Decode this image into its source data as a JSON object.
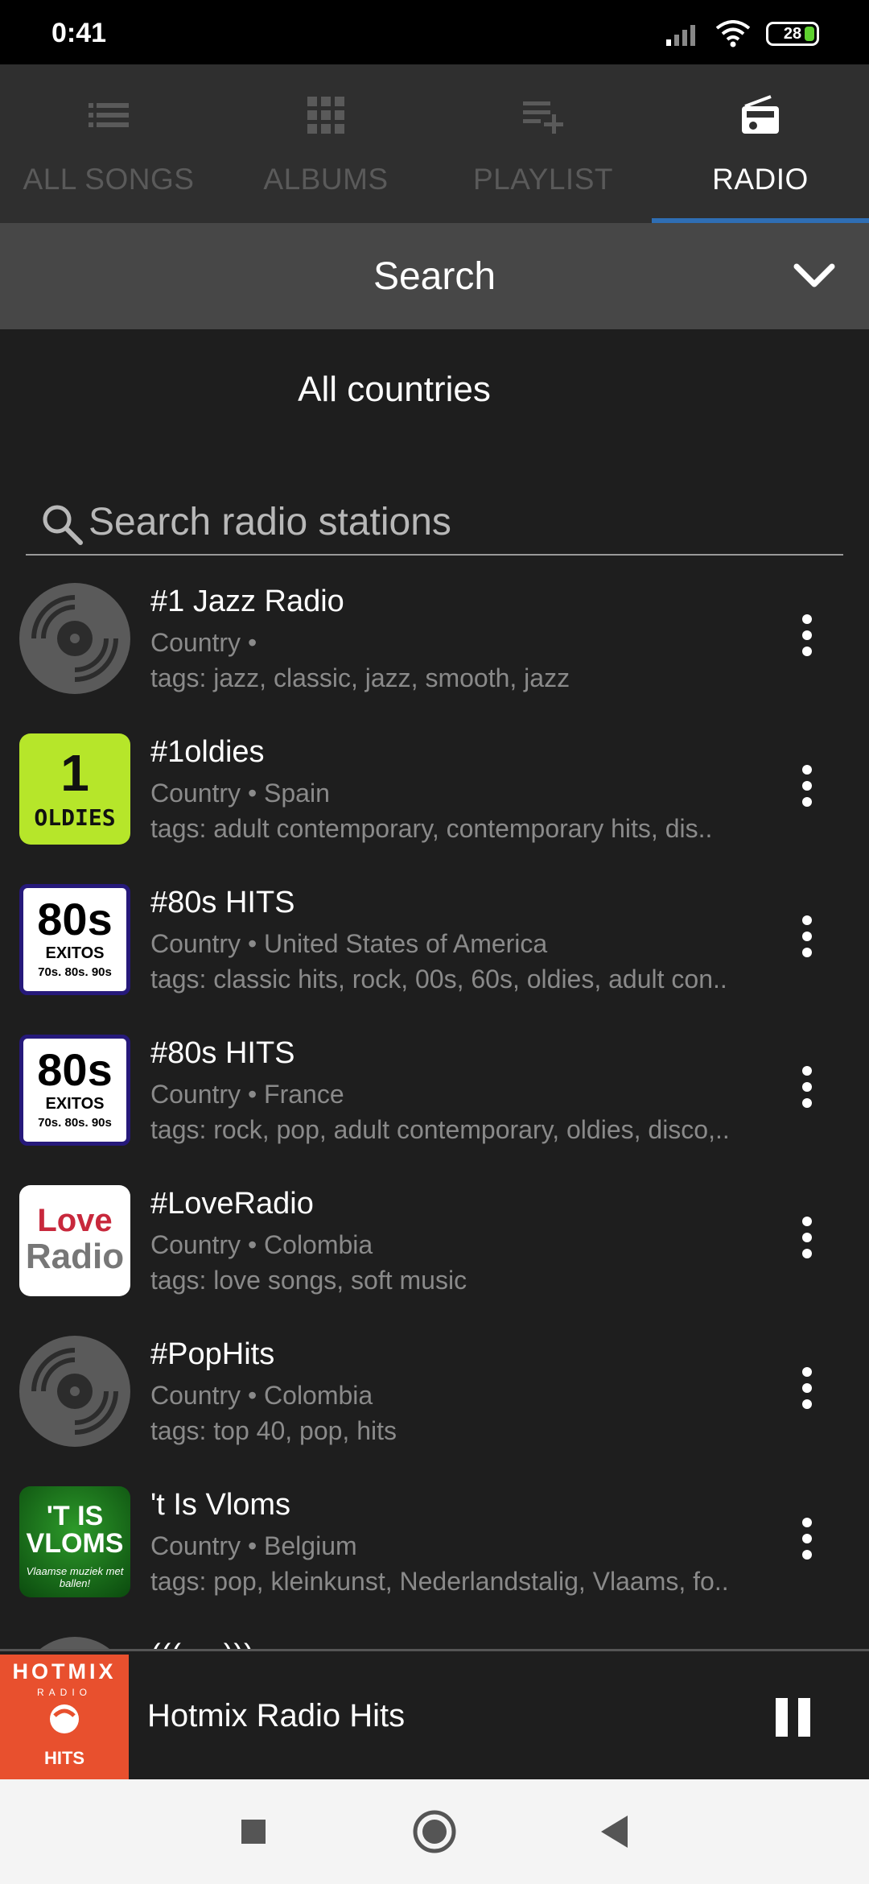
{
  "status": {
    "time": "0:41",
    "battery": "28"
  },
  "tabs": [
    {
      "label": "ALL SONGS",
      "icon": "list-icon",
      "active": false
    },
    {
      "label": "ALBUMS",
      "icon": "grid-icon",
      "active": false
    },
    {
      "label": "PLAYLIST",
      "icon": "playlist-add-icon",
      "active": false
    },
    {
      "label": "RADIO",
      "icon": "radio-icon",
      "active": true
    }
  ],
  "search": {
    "title": "Search",
    "field_placeholder": "Search radio stations"
  },
  "country_filter": {
    "selected": "All countries"
  },
  "stations": [
    {
      "name": "#1 Jazz Radio",
      "meta": "Country •",
      "tags": "tags: jazz, classic, jazz, smooth, jazz",
      "art": "vinyl"
    },
    {
      "name": "#1oldies",
      "meta": "Country • Spain",
      "tags": "tags: adult contemporary, contemporary hits, dis..",
      "art": "oldies",
      "art_text_1": "1",
      "art_text_2": "OLDIES"
    },
    {
      "name": "#80s HITS",
      "meta": "Country • United States of America",
      "tags": "tags: classic hits, rock, 00s, 60s, oldies, adult con..",
      "art": "80s",
      "art_text_1": "80s",
      "art_text_2": "EXITOS",
      "art_text_3": "70s. 80s. 90s"
    },
    {
      "name": "#80s HITS",
      "meta": "Country • France",
      "tags": "tags: rock, pop, adult contemporary, oldies, disco,..",
      "art": "80s",
      "art_text_1": "80s",
      "art_text_2": "EXITOS",
      "art_text_3": "70s. 80s. 90s"
    },
    {
      "name": "#LoveRadio",
      "meta": "Country • Colombia",
      "tags": "tags: love songs, soft music",
      "art": "love",
      "art_text_1": "Love",
      "art_text_2": "Radio"
    },
    {
      "name": "#PopHits",
      "meta": "Country • Colombia",
      "tags": "tags: top 40, pop, hits",
      "art": "vinyl"
    },
    {
      "name": "'t Is Vloms",
      "meta": "Country • Belgium",
      "tags": "tags: pop, kleinkunst, Nederlandstalig, Vlaams, fo..",
      "art": "vloms",
      "art_text_1": "'T IS",
      "art_text_2": "VLOMS",
      "art_text_3": "Vlaamse muziek met ballen!"
    },
    {
      "name": "((( ... )))",
      "meta": "",
      "tags": "",
      "art": "vinyl"
    }
  ],
  "player": {
    "title": "Hotmix Radio Hits",
    "art_text_1": "HOTMIX",
    "art_text_2": "RADIO",
    "art_text_3": "HITS"
  },
  "colors": {
    "accent": "#2f6eb4",
    "background": "#1e1e1e",
    "tabbar": "#2f2f2f",
    "searchbar": "#474747",
    "hotmix": "#e8502e"
  }
}
